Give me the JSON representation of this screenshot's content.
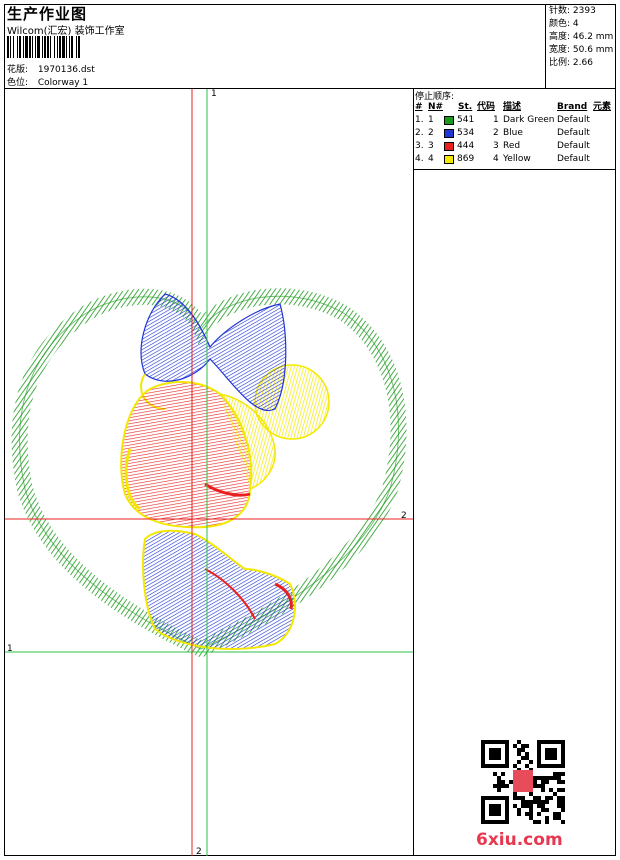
{
  "header": {
    "title": "生产作业图",
    "studio": "Wilcom(汇宏)  装饰工作室",
    "file_label": "花版:",
    "file_value": "1970136.dst",
    "colorway_label": "色位:",
    "colorway_value": "Colorway 1"
  },
  "stats": {
    "stitches": "针数: 2393",
    "colors": "颜色: 4",
    "height": "高度: 46.2 mm",
    "width": "宽度: 50.6 mm",
    "ratio": "比例: 2.66"
  },
  "stop_sequence": {
    "title": "停止顺序:",
    "headers": [
      "#",
      "N#",
      "St.",
      "代码",
      "描述",
      "Brand",
      "元素"
    ],
    "rows": [
      {
        "idx": "1.",
        "n": "1",
        "st": "541",
        "code": "1",
        "desc": "Dark Green",
        "brand": "Default",
        "color": "#1a9a1a"
      },
      {
        "idx": "2.",
        "n": "2",
        "st": "534",
        "code": "2",
        "desc": "Blue",
        "brand": "Default",
        "color": "#1f35d6"
      },
      {
        "idx": "3.",
        "n": "3",
        "st": "444",
        "code": "3",
        "desc": "Red",
        "brand": "Default",
        "color": "#e82020"
      },
      {
        "idx": "4.",
        "n": "4",
        "st": "869",
        "code": "4",
        "desc": "Yellow",
        "brand": "Default",
        "color": "#f5e800"
      }
    ]
  },
  "axes": {
    "top_green": "1",
    "right_red": "2",
    "left_green": "1",
    "bottom_red": "2"
  },
  "watermark": "6xiu.com",
  "colors": {
    "green": "#1a9a1a",
    "blue": "#1f35d6",
    "red": "#e82020",
    "yellow": "#f5e800",
    "guide_red": "#e82020",
    "guide_green": "#2fc24a"
  }
}
